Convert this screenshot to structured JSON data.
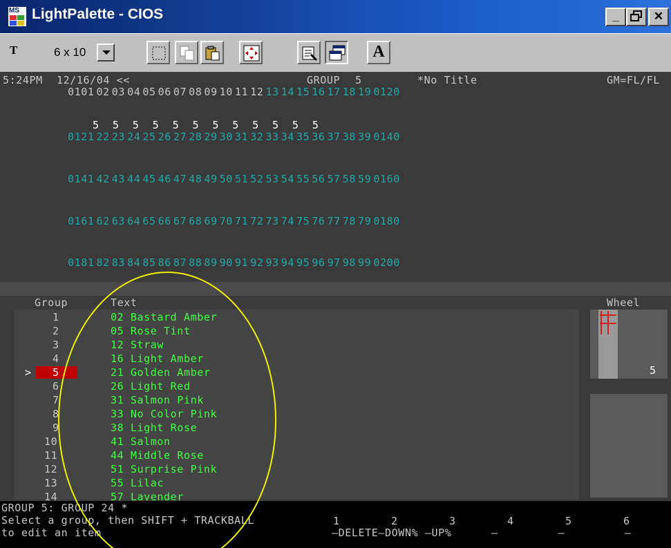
{
  "window": {
    "logo_text": "MS",
    "title": "LightPalette - CIOS",
    "controls": {
      "minimize": "_",
      "maximize": "Б",
      "close": "✕"
    }
  },
  "toolbar": {
    "font_icon": "T",
    "font_size": "6 x 10",
    "a_button": "A"
  },
  "header": {
    "time": "5:24PM",
    "date": "12/16/04 <<",
    "group_label": "GROUP",
    "group_num": "5",
    "title": "*No Title",
    "gm": "GM=FL/FL"
  },
  "channel_rows": [
    {
      "label_row": [
        "0101",
        "02",
        "03",
        "04",
        "05",
        "06",
        "07",
        "08",
        "09",
        "10",
        "11",
        "12",
        "13",
        "14",
        "15",
        "16",
        "17",
        "18",
        "19",
        "0120"
      ],
      "white_until": 12,
      "levels": ""
    },
    {
      "label_row": [
        "0121",
        "22",
        "23",
        "24",
        "25",
        "26",
        "27",
        "28",
        "29",
        "30",
        "31",
        "32",
        "33",
        "34",
        "35",
        "36",
        "37",
        "38",
        "39",
        "0140"
      ],
      "white_until": 0,
      "levels": "5  5  5  5  5  5  5  5  5  5  5  5"
    },
    {
      "label_row": [
        "0141",
        "42",
        "43",
        "44",
        "45",
        "46",
        "47",
        "48",
        "49",
        "50",
        "51",
        "52",
        "53",
        "54",
        "55",
        "56",
        "57",
        "58",
        "59",
        "0160"
      ],
      "white_until": 0,
      "levels": ""
    },
    {
      "label_row": [
        "0161",
        "62",
        "63",
        "64",
        "65",
        "66",
        "67",
        "68",
        "69",
        "70",
        "71",
        "72",
        "73",
        "74",
        "75",
        "76",
        "77",
        "78",
        "79",
        "0180"
      ],
      "white_until": 0,
      "levels": ""
    },
    {
      "label_row": [
        "0181",
        "82",
        "83",
        "84",
        "85",
        "86",
        "87",
        "88",
        "89",
        "90",
        "91",
        "92",
        "93",
        "94",
        "95",
        "96",
        "97",
        "98",
        "99",
        "0200"
      ],
      "white_until": 0,
      "levels": ""
    }
  ],
  "list": {
    "col_group": "Group",
    "col_text": "Text",
    "col_wheel": "Wheel",
    "wheel_value": "5",
    "selected_marker": ">",
    "rows": [
      {
        "group": "1",
        "text": "02 Bastard Amber"
      },
      {
        "group": "2",
        "text": "05 Rose Tint"
      },
      {
        "group": "3",
        "text": "12 Straw"
      },
      {
        "group": "4",
        "text": "16 Light Amber"
      },
      {
        "group": "5",
        "text": "21 Golden Amber"
      },
      {
        "group": "6",
        "text": "26 Light Red"
      },
      {
        "group": "7",
        "text": "31 Salmon Pink"
      },
      {
        "group": "8",
        "text": "33 No Color Pink"
      },
      {
        "group": "9",
        "text": "38 Light Rose"
      },
      {
        "group": "10",
        "text": "41 Salmon"
      },
      {
        "group": "11",
        "text": "44 Middle Rose"
      },
      {
        "group": "12",
        "text": "51 Surprise Pink"
      },
      {
        "group": "13",
        "text": "55 Lilac"
      },
      {
        "group": "14",
        "text": "57 Lavender"
      }
    ]
  },
  "status": {
    "line1": "GROUP 5: GROUP 24 *",
    "line2": "Select a group, then SHIFT + TRACKBALL",
    "line3": "to edit an item",
    "softkey_numbers": [
      "1",
      "2",
      "3",
      "4",
      "5",
      "6"
    ],
    "softkey_labels": "–DELETE–DOWN% –UP%      –         –         –"
  },
  "colors": {
    "channel_teal": "#22a8a8",
    "list_green": "#40ff40",
    "selection_red": "#c00000",
    "annotation_circle": "#f0f000"
  }
}
